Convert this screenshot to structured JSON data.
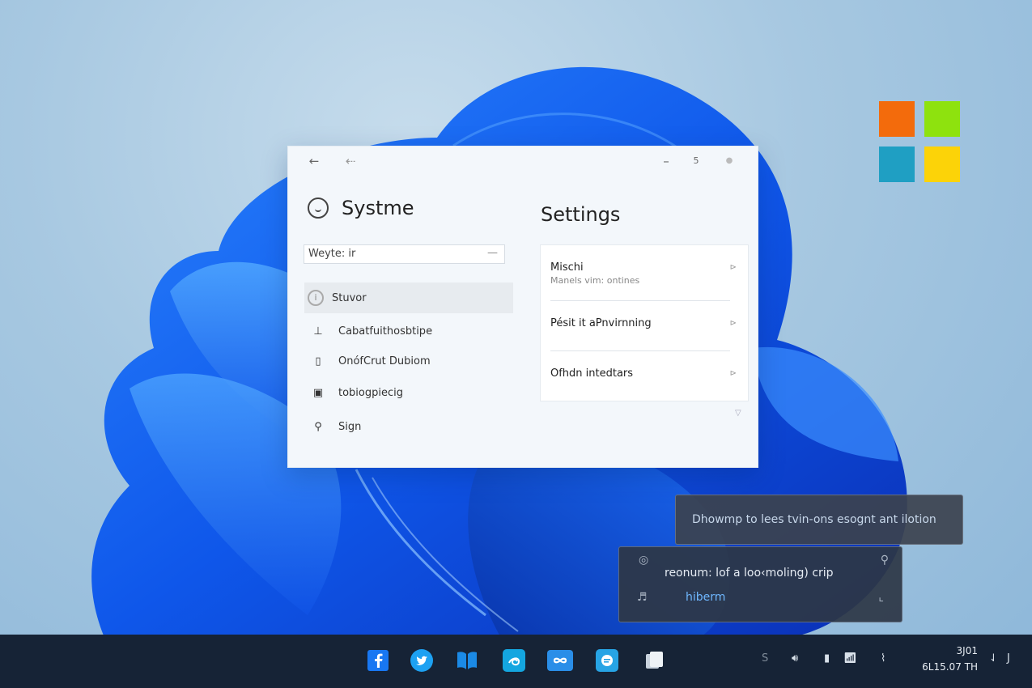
{
  "window": {
    "app_title": "Systme",
    "search_value": "Weyte: ir",
    "nav": [
      {
        "label": "Stuvor",
        "icon": "info-circle-icon",
        "glyph": "i"
      },
      {
        "label": "Cabatfuithosbtipe",
        "icon": "pin-icon",
        "glyph": "⊥"
      },
      {
        "label": "OnófCrut Dubiom",
        "icon": "document-icon",
        "glyph": "▯"
      },
      {
        "label": "tobiogpiecig",
        "icon": "bag-icon",
        "glyph": "▣"
      },
      {
        "label": "Sign",
        "icon": "key-icon",
        "glyph": "⚲"
      }
    ],
    "main_title": "Settings",
    "settings_rows": [
      {
        "title": "Mischi",
        "subtitle": "Manels vim:  ontines"
      },
      {
        "title": "Pésit it aPnvirnning",
        "subtitle": ""
      },
      {
        "title": "Ofhdn intedtars",
        "subtitle": ""
      }
    ]
  },
  "notifications": [
    {
      "message": "Dhowmp to lees  tvin-ons  esognt ant ilotion"
    },
    {
      "message": "reonum: lof a loo‹moling) cri​p",
      "link": "hiberm"
    }
  ],
  "taskbar": {
    "apps": [
      {
        "name": "facebook-icon",
        "color": "#1877f2"
      },
      {
        "name": "twitter-icon",
        "color": "#1da1f2"
      },
      {
        "name": "book-icon",
        "color": "#1b8ae6"
      },
      {
        "name": "spiral-app-icon",
        "color": "#14a6e0"
      },
      {
        "name": "infinity-app-icon",
        "color": "#2a8ee8"
      },
      {
        "name": "chat-app-icon",
        "color": "#27a4e5"
      },
      {
        "name": "files-app-icon",
        "color": "#e6ecf3"
      }
    ],
    "clock_time": "3J01",
    "clock_date": "6L15.07 TH",
    "tray_end": "J"
  },
  "colors": {
    "taskbar_bg": "#162336",
    "accent": "#1a5cf0",
    "logo": [
      "#f36b0c",
      "#8ee20e",
      "#1f9fc3",
      "#fcd308"
    ]
  }
}
